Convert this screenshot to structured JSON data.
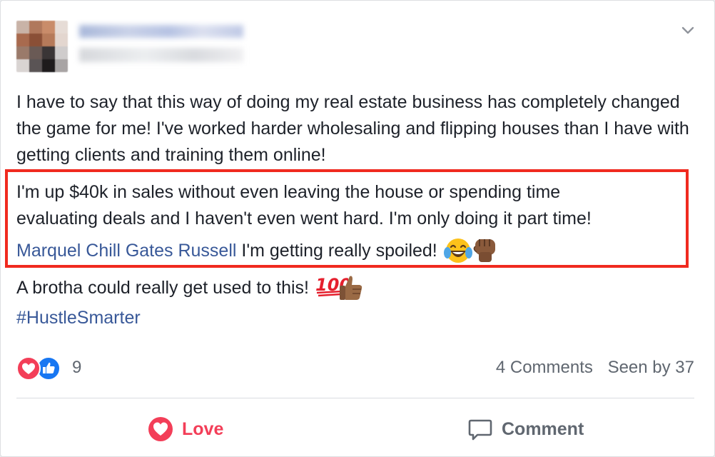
{
  "post": {
    "author_name": "",
    "paragraph1": "I have to say that this way of doing my real estate business has completely changed the game for me! I've worked harder wholesaling and flipping houses than I have with getting clients and training them online!",
    "highlight_line1": "I'm up $40k in sales without even leaving the house or spending time",
    "highlight_line2": "evaluating deals and I haven't even went hard. I'm only doing it part time!",
    "mention": "Marquel Chill Gates Russell",
    "highlight_line3_rest": " I'm getting really spoiled! ",
    "paragraph3": "A brotha could really get used to this! ",
    "hashtag": "#HustleSmarter"
  },
  "reactions": {
    "count": "9",
    "icons": [
      "love-reaction-icon",
      "like-reaction-icon"
    ]
  },
  "stats": {
    "comments": "4 Comments",
    "seen": "Seen by 37"
  },
  "actions": {
    "love_label": "Love",
    "comment_label": "Comment"
  },
  "colors": {
    "highlight_border": "#f02a1f",
    "link": "#385898",
    "love": "#f33e58",
    "like": "#1877f2"
  }
}
